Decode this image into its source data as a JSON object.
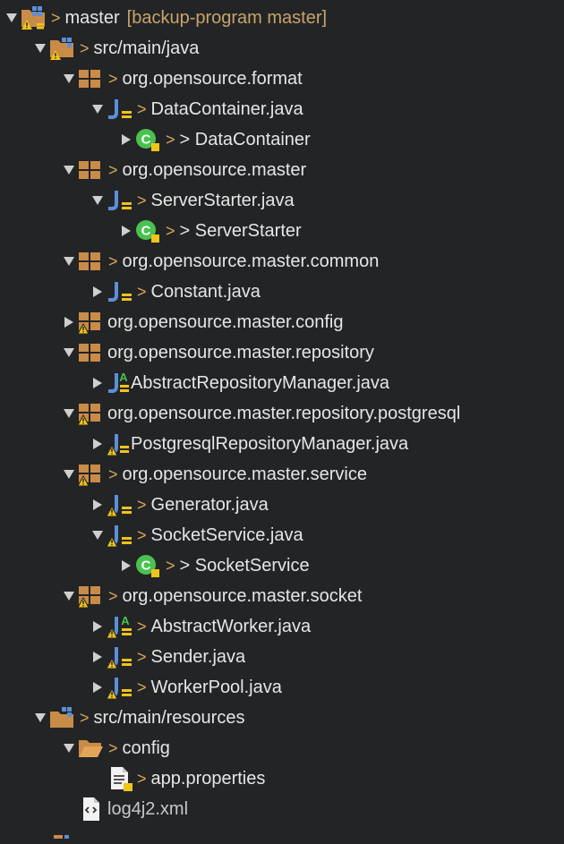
{
  "tree": {
    "root": {
      "label": "master",
      "suffix": "[backup-program master]",
      "icon": "project-folder-icon"
    },
    "nodes": [
      {
        "label": "src/main/java",
        "icon": "source-folder-icon"
      },
      {
        "label": "org.opensource.format",
        "icon": "package-icon"
      },
      {
        "label": "DataContainer.java",
        "icon": "java-file-icon"
      },
      {
        "label": "> DataContainer",
        "icon": "class-icon"
      },
      {
        "label": "org.opensource.master",
        "icon": "package-icon"
      },
      {
        "label": "ServerStarter.java",
        "icon": "java-file-icon"
      },
      {
        "label": "> ServerStarter",
        "icon": "class-icon"
      },
      {
        "label": "org.opensource.master.common",
        "icon": "package-icon"
      },
      {
        "label": "Constant.java",
        "icon": "java-file-icon"
      },
      {
        "label": "org.opensource.master.config",
        "icon": "package-icon"
      },
      {
        "label": "org.opensource.master.repository",
        "icon": "package-icon"
      },
      {
        "label": "AbstractRepositoryManager.java",
        "icon": "java-file-icon"
      },
      {
        "label": "org.opensource.master.repository.postgresql",
        "icon": "package-icon"
      },
      {
        "label": "PostgresqlRepositoryManager.java",
        "icon": "java-file-icon"
      },
      {
        "label": "org.opensource.master.service",
        "icon": "package-icon"
      },
      {
        "label": "Generator.java",
        "icon": "java-file-icon"
      },
      {
        "label": "SocketService.java",
        "icon": "java-file-icon"
      },
      {
        "label": "> SocketService",
        "icon": "class-icon"
      },
      {
        "label": "org.opensource.master.socket",
        "icon": "package-icon"
      },
      {
        "label": "AbstractWorker.java",
        "icon": "java-file-icon"
      },
      {
        "label": "Sender.java",
        "icon": "java-file-icon"
      },
      {
        "label": "WorkerPool.java",
        "icon": "java-file-icon"
      },
      {
        "label": "src/main/resources",
        "icon": "source-folder-icon"
      },
      {
        "label": "config",
        "icon": "folder-icon"
      },
      {
        "label": "app.properties",
        "icon": "properties-file-icon"
      },
      {
        "label": "log4j2.xml",
        "icon": "xml-file-icon"
      }
    ]
  },
  "colors": {
    "background": "#232425",
    "text": "#e6e6e6",
    "dirty_marker": "#d6a85a",
    "branch_suffix": "#c8a46a",
    "java_icon": "#5b8fd9",
    "class_icon": "#49c24f",
    "package_icon": "#c98b48",
    "warning": "#f0c419"
  }
}
